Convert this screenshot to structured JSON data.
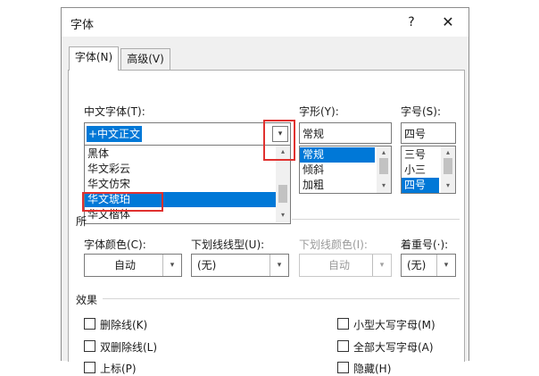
{
  "dialog": {
    "title": "字体",
    "help_label": "?",
    "close_label": "✕"
  },
  "tabs": [
    {
      "label": "字体(N)",
      "active": true
    },
    {
      "label": "高级(V)",
      "active": false
    }
  ],
  "chinese_font": {
    "label": "中文字体(T):",
    "value": "+中文正文",
    "options": [
      "黑体",
      "华文彩云",
      "华文仿宋",
      "华文琥珀",
      "华文楷体"
    ],
    "selected": "华文琥珀"
  },
  "font_style": {
    "label": "字形(Y):",
    "value": "常规",
    "options": [
      "常规",
      "倾斜",
      "加粗"
    ],
    "selected": "常规"
  },
  "font_size": {
    "label": "字号(S):",
    "value": "四号",
    "options": [
      "三号",
      "小三",
      "四号"
    ],
    "selected": "四号"
  },
  "all_text": {
    "label_partial": "所",
    "font_color": {
      "label": "字体颜色(C):",
      "value": "自动"
    },
    "underline_style": {
      "label": "下划线线型(U):",
      "value": "(无)"
    },
    "underline_color": {
      "label": "下划线颜色(I):",
      "value": "自动"
    },
    "emphasis": {
      "label": "着重号(·):",
      "value": "(无)"
    }
  },
  "effects": {
    "label": "效果",
    "left": [
      "删除线(K)",
      "双删除线(L)",
      "上标(P)"
    ],
    "right": [
      "小型大写字母(M)",
      "全部大写字母(A)",
      "隐藏(H)"
    ]
  },
  "icons": {
    "dropdown": "▾",
    "scroll_up": "▴",
    "scroll_down": "▾"
  },
  "colors": {
    "selection": "#0078d7",
    "highlight_annotation": "#e0312f"
  }
}
